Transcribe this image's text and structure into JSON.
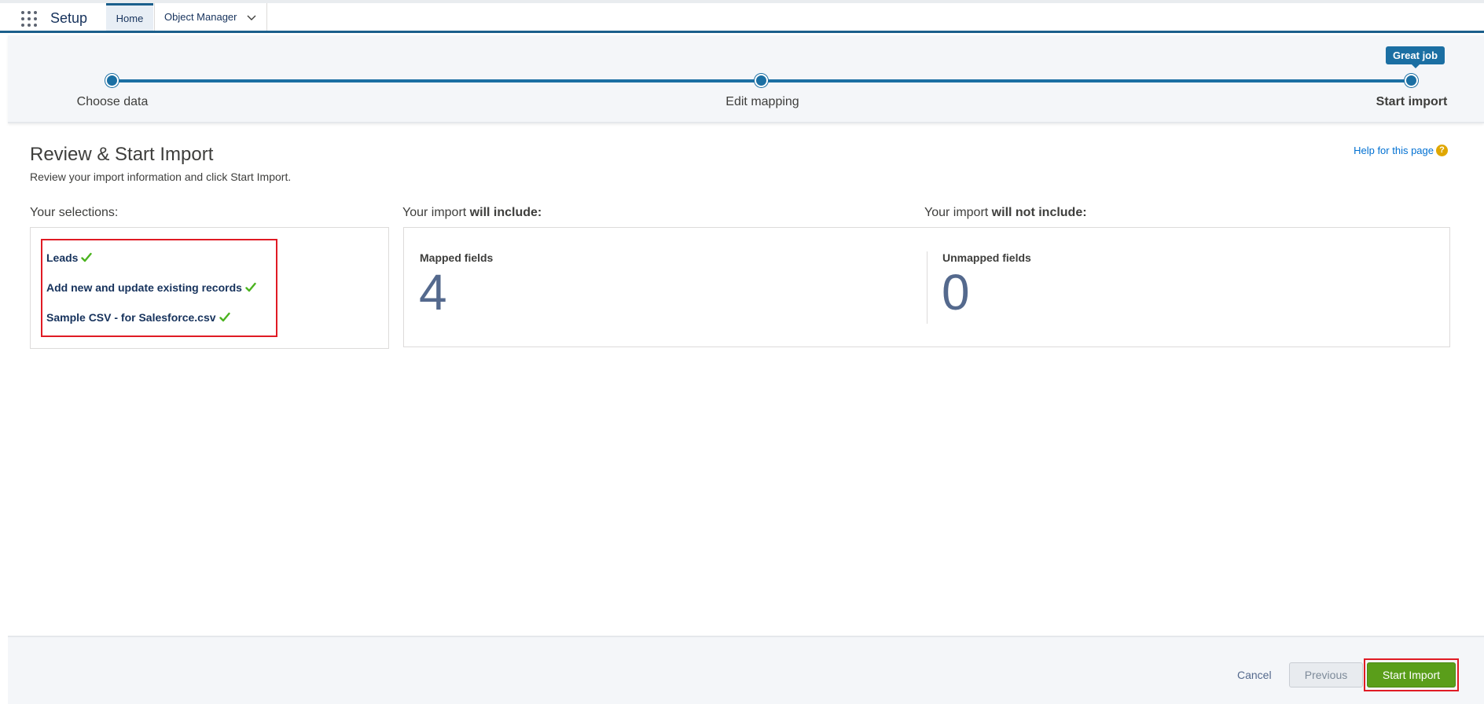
{
  "topbar": {
    "app_name": "Setup",
    "tabs": [
      {
        "label": "Home"
      },
      {
        "label": "Object Manager"
      }
    ]
  },
  "progress": {
    "steps": [
      {
        "label": "Choose data"
      },
      {
        "label": "Edit mapping"
      },
      {
        "label": "Start import"
      }
    ],
    "current_step": 3,
    "tooltip": "Great job"
  },
  "page": {
    "title": "Review & Start Import",
    "subtitle": "Review your import information and click Start Import.",
    "help_link": "Help for this page",
    "help_icon_glyph": "?"
  },
  "selections": {
    "heading": "Your selections:",
    "items": [
      {
        "label": "Leads"
      },
      {
        "label": "Add new and update existing records"
      },
      {
        "label": "Sample CSV - for Salesforce.csv"
      }
    ]
  },
  "include": {
    "heading_prefix": "Your import ",
    "heading_bold": "will include:",
    "label": "Mapped fields",
    "count": "4"
  },
  "exclude": {
    "heading_prefix": "Your import ",
    "heading_bold": "will not include:",
    "label": "Unmapped fields",
    "count": "0"
  },
  "footer": {
    "cancel_label": "Cancel",
    "previous_label": "Previous",
    "start_label": "Start Import"
  },
  "colors": {
    "brand_blue": "#1b6fa3",
    "nav_border": "#1b5f8c",
    "success_green": "#5a9e1a",
    "check_green": "#4bb31f",
    "highlight_red": "#e01b24",
    "link_blue": "#0070d2"
  }
}
